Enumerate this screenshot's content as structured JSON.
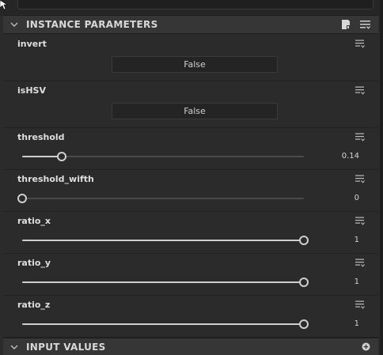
{
  "instance_section": {
    "title": "INSTANCE PARAMETERS",
    "icons": [
      "save-preset-icon",
      "list-menu-icon"
    ]
  },
  "params": [
    {
      "name": "invert",
      "kind": "bool",
      "value": "False"
    },
    {
      "name": "isHSV",
      "kind": "bool",
      "value": "False"
    },
    {
      "name": "threshold",
      "kind": "slider",
      "value_text": "0.14",
      "level": 0.14
    },
    {
      "name": "threshold_wifth",
      "kind": "slider",
      "value_text": "0",
      "level": 0
    },
    {
      "name": "ratio_x",
      "kind": "slider",
      "value_text": "1",
      "level": 1
    },
    {
      "name": "ratio_y",
      "kind": "slider",
      "value_text": "1",
      "level": 1
    },
    {
      "name": "ratio_z",
      "kind": "slider",
      "value_text": "1",
      "level": 1
    }
  ],
  "input_section": {
    "title": "INPUT VALUES",
    "icons": [
      "add-icon"
    ]
  },
  "colors": {
    "panel_bg": "#2b2b2b",
    "header_bg": "#363636",
    "field_bg": "#242424",
    "accent": "#cfcfcf"
  }
}
